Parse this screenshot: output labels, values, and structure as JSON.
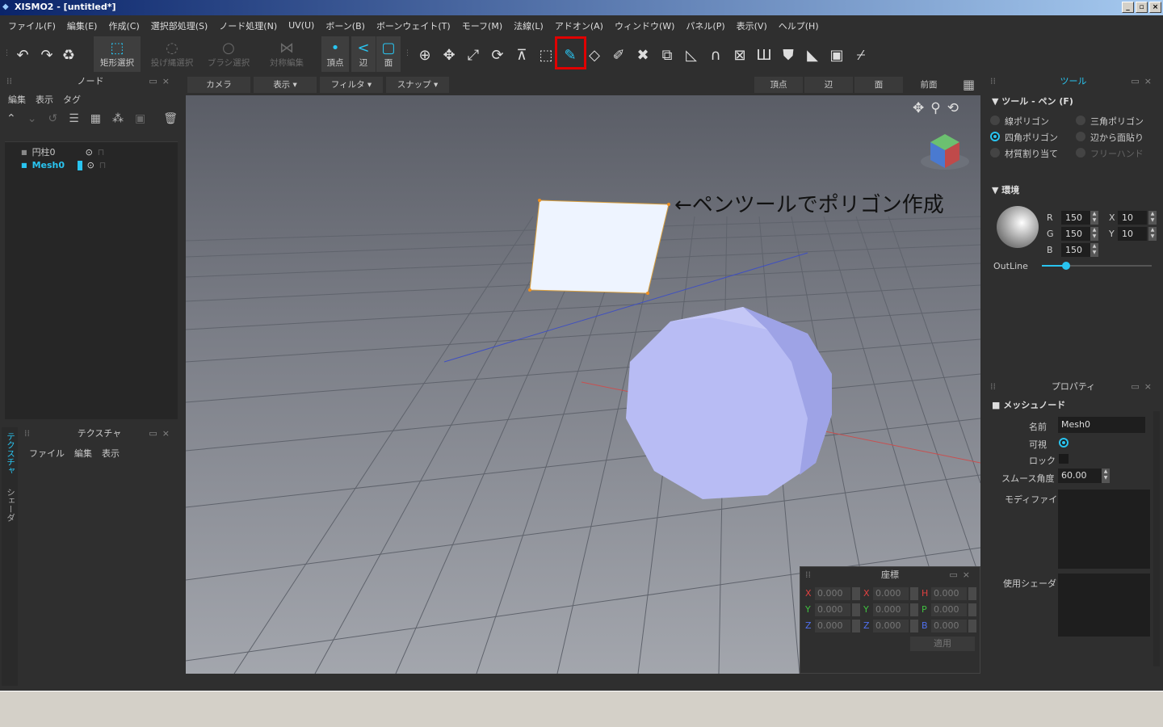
{
  "window": {
    "title": "XISMO2 - [untitled*]"
  },
  "menu": [
    "ファイル(F)",
    "編集(E)",
    "作成(C)",
    "選択部処理(S)",
    "ノード処理(N)",
    "UV(U)",
    "ボーン(B)",
    "ボーンウェイト(T)",
    "モーフ(M)",
    "法線(L)",
    "アドオン(A)",
    "ウィンドウ(W)",
    "パネル(P)",
    "表示(V)",
    "ヘルプ(H)"
  ],
  "toolbar": {
    "rect_select": "矩形選択",
    "lasso_select": "投げ縄選択",
    "brush_select": "ブラシ選択",
    "symmetry_edit": "対称編集",
    "vertex": "頂点",
    "edge": "辺",
    "face": "面"
  },
  "node_panel": {
    "title": "ノード",
    "menu": [
      "編集",
      "表示",
      "タグ"
    ],
    "items": [
      {
        "label": "円柱0",
        "selected": false
      },
      {
        "label": "Mesh0",
        "selected": true
      }
    ]
  },
  "texture_panel": {
    "title": "テクスチャ",
    "menu": [
      "ファイル",
      "編集",
      "表示"
    ]
  },
  "side_tabs": [
    "テクスチャ",
    "シェーダ"
  ],
  "viewport": {
    "buttons_left": [
      "カメラ",
      "表示",
      "フィルタ",
      "スナップ"
    ],
    "buttons_right": [
      "頂点",
      "辺",
      "面",
      "前面"
    ],
    "annotation": "←ペンツールでポリゴン作成"
  },
  "tool_panel": {
    "title": "ツール",
    "section": "ツール - ペン (F)",
    "options": [
      {
        "label": "線ポリゴン",
        "checked": false,
        "dim": false
      },
      {
        "label": "三角ポリゴン",
        "checked": false,
        "dim": false
      },
      {
        "label": "四角ポリゴン",
        "checked": true,
        "dim": false
      },
      {
        "label": "辺から面貼り",
        "checked": false,
        "dim": false
      },
      {
        "label": "材質割り当て",
        "checked": false,
        "dim": false
      },
      {
        "label": "フリーハンド",
        "checked": false,
        "dim": true
      }
    ],
    "env_title": "環境",
    "r_label": "R",
    "r": "150",
    "g_label": "G",
    "g": "150",
    "b_label": "B",
    "b": "150",
    "x_label": "X",
    "x": "10",
    "y_label": "Y",
    "y": "10",
    "outline_label": "OutLine",
    "outline_level": 0.22
  },
  "property_panel": {
    "title": "プロパティ",
    "section": "メッシュノード",
    "name_label": "名前",
    "name_value": "Mesh0",
    "visible_label": "可視",
    "lock_label": "ロック",
    "smooth_label": "スムース角度",
    "smooth_value": "60.00",
    "modifier_label": "モディファイア",
    "shader_label": "使用シェーダ"
  },
  "coord_panel": {
    "title": "座標",
    "rows": [
      {
        "a": "X",
        "av": "0.000",
        "b": "X",
        "bv": "0.000",
        "c": "H",
        "cv": "0.000"
      },
      {
        "a": "Y",
        "av": "0.000",
        "b": "Y",
        "bv": "0.000",
        "c": "P",
        "cv": "0.000"
      },
      {
        "a": "Z",
        "av": "0.000",
        "b": "Z",
        "bv": "0.000",
        "c": "B",
        "cv": "0.000"
      }
    ],
    "apply": "適用"
  },
  "colors": {
    "accent": "#29c4f0",
    "highlight_box": "#e00000",
    "x_axis": "#e04040",
    "y_axis": "#40c040",
    "z_axis": "#4060e0"
  }
}
